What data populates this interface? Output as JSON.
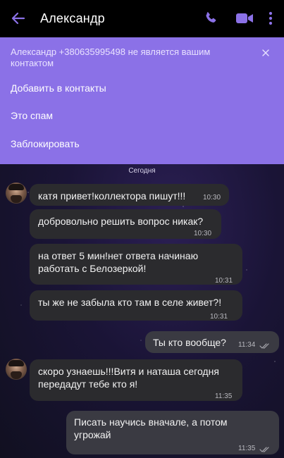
{
  "header": {
    "title": "Александр",
    "back_icon": "arrow-left-icon",
    "call_icon": "phone-icon",
    "video_icon": "video-camera-icon",
    "more_icon": "more-vertical-icon",
    "accent_color": "#8b71e7"
  },
  "contact_panel": {
    "notice": "Александр +380635995498 не является вашим контактом",
    "add_label": "Добавить в контакты",
    "spam_label": "Это спам",
    "block_label": "Заблокировать",
    "close_icon": "close-icon"
  },
  "chat": {
    "date_separator": "Сегодня",
    "messages": [
      {
        "direction": "incoming",
        "text": "катя привет!коллектора пишут!!!",
        "time": "10:30"
      },
      {
        "direction": "incoming",
        "text": "добровольно решить вопрос никак?",
        "time": "10:30"
      },
      {
        "direction": "incoming",
        "text": "на ответ 5 мин!нет ответа начинаю работать с Белозеркой!",
        "time": "10:31"
      },
      {
        "direction": "incoming",
        "text": "ты же не забыла кто там в селе живет?!",
        "time": "10:31"
      },
      {
        "direction": "outgoing",
        "text": "Ты кто вообще?",
        "time": "11:34",
        "status": "read"
      },
      {
        "direction": "incoming",
        "text": "скоро узнаешь!!!Витя и наташа сегодня передадут тебе кто я!",
        "time": "11:35"
      },
      {
        "direction": "outgoing",
        "text": "Писать научись вначале, а потом угрожай",
        "time": "11:35",
        "status": "read"
      }
    ]
  }
}
